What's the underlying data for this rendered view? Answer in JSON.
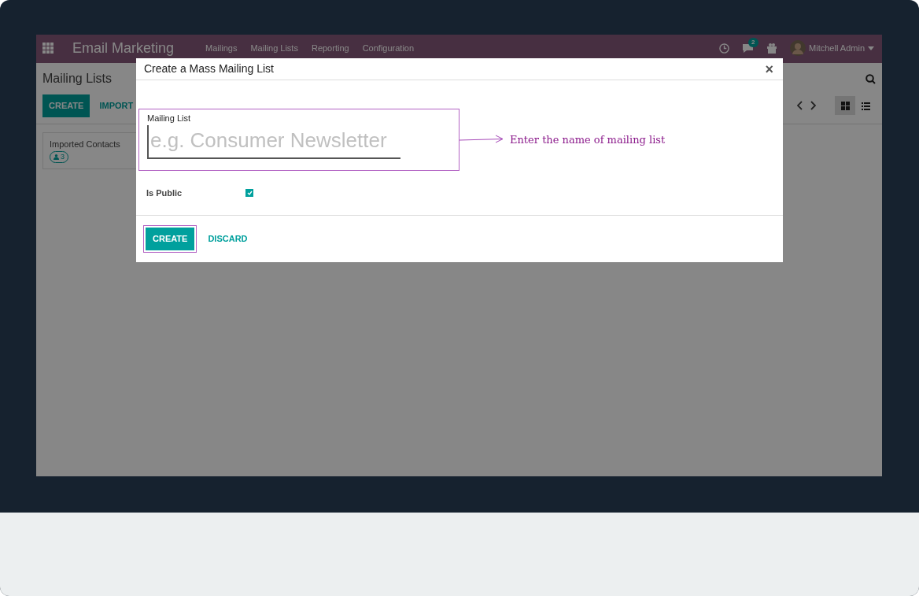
{
  "navbar": {
    "brand": "Email Marketing",
    "menu": [
      "Mailings",
      "Mailing Lists",
      "Reporting",
      "Configuration"
    ],
    "messages_badge": "2",
    "user": "Mitchell Admin"
  },
  "control_panel": {
    "title": "Mailing Lists",
    "buttons": [
      {
        "label": "CREATE",
        "kind": "primary"
      },
      {
        "label": "IMPORT",
        "kind": "link"
      }
    ],
    "views": [
      {
        "kind": "kanban",
        "selected": true
      },
      {
        "kind": "list",
        "selected": false
      }
    ]
  },
  "kanban_cards": [
    {
      "name": "Imported Contacts",
      "count": "3"
    }
  ],
  "dialog": {
    "title": "Create a Mass Mailing List",
    "close": "×",
    "fields": [
      {
        "kind": "text",
        "label": "Mailing List",
        "placeholder": "e.g. Consumer Newsletter"
      },
      {
        "kind": "checkbox",
        "label": "Is Public",
        "checked": true
      }
    ],
    "buttons": [
      {
        "label": "CREATE",
        "kind": "primary"
      },
      {
        "label": "DISCARD",
        "kind": "link"
      }
    ]
  },
  "annotation": {
    "text": "Enter the name of mailing list"
  }
}
